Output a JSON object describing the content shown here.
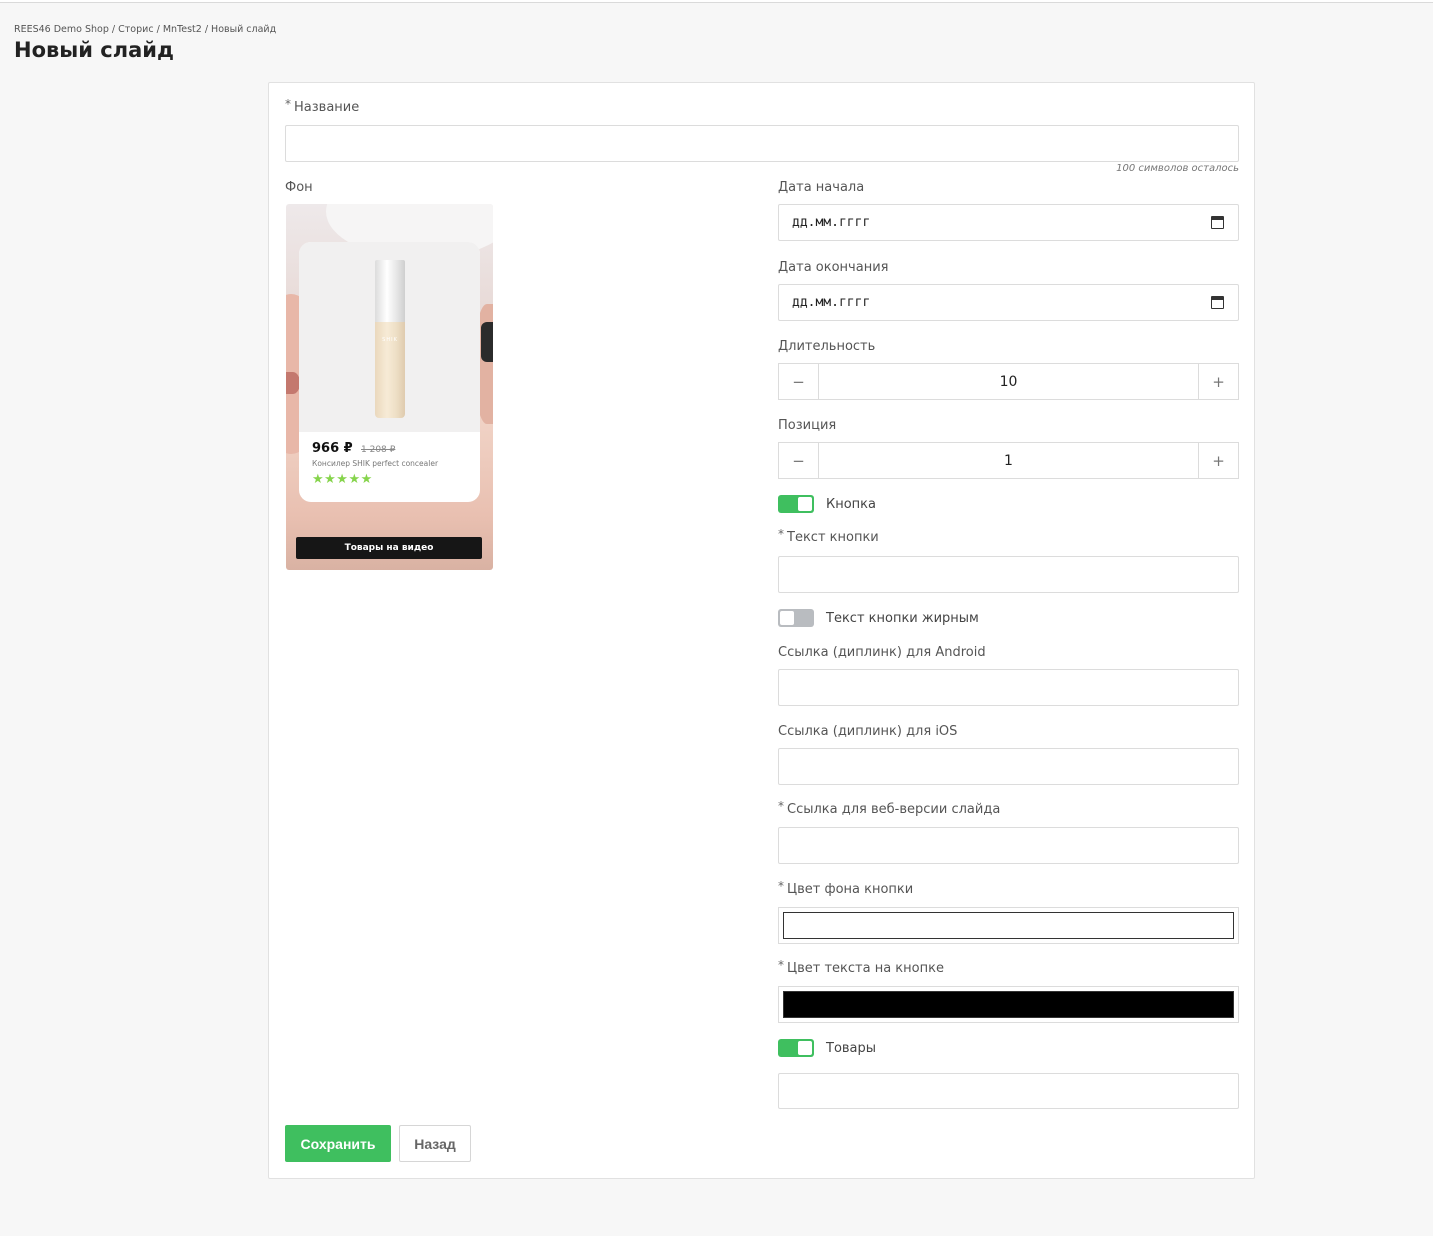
{
  "breadcrumb": {
    "items": [
      "REES46 Demo Shop",
      "Сторис",
      "MnTest2",
      "Новый слайд"
    ],
    "separator": " / "
  },
  "page_title": "Новый слайд",
  "form": {
    "required_mark": "*",
    "name": {
      "label": "Название",
      "value": "",
      "hint": "100 символов осталось"
    },
    "background": {
      "label": "Фон",
      "preview": {
        "price": "966 ₽",
        "old_price": "1 208 ₽",
        "product_name": "Консилер SHIK perfect concealer",
        "rating_stars": 5,
        "stars_text": "★★★★★",
        "brand": "SHIK",
        "cta_label": "Товары на видео"
      }
    },
    "start_date": {
      "label": "Дата начала",
      "placeholder": "дд.мм.гггг"
    },
    "end_date": {
      "label": "Дата окончания",
      "placeholder": "дд.мм.гггг"
    },
    "duration": {
      "label": "Длительность",
      "value": "10",
      "minus": "−",
      "plus": "+"
    },
    "position": {
      "label": "Позиция",
      "value": "1",
      "minus": "−",
      "plus": "+"
    },
    "button_toggle": {
      "label": "Кнопка",
      "on": true
    },
    "button_text": {
      "label": "Текст кнопки",
      "value": ""
    },
    "button_bold_toggle": {
      "label": "Текст кнопки жирным",
      "on": false
    },
    "android_link": {
      "label": "Ссылка (диплинк) для Android",
      "value": ""
    },
    "ios_link": {
      "label": "Ссылка (диплинк) для iOS",
      "value": ""
    },
    "web_link": {
      "label": "Ссылка для веб-версии слайда",
      "value": ""
    },
    "button_bg_color": {
      "label": "Цвет фона кнопки",
      "value": "#ffffff"
    },
    "button_text_color": {
      "label": "Цвет текста на кнопке",
      "value": "#000000"
    },
    "products_toggle": {
      "label": "Товары",
      "on": true
    },
    "products_input": {
      "value": ""
    }
  },
  "actions": {
    "save_label": "Сохранить",
    "back_label": "Назад"
  },
  "colors": {
    "accent": "#3fbf5f",
    "toggle_off": "#b9bcc0",
    "stars": "#86d44c"
  }
}
